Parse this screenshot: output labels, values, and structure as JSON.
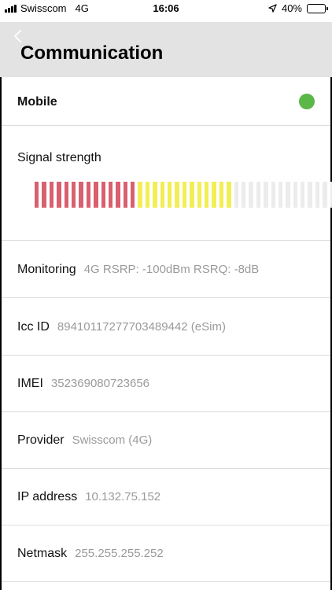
{
  "status_bar": {
    "carrier": "Swisscom",
    "network": "4G",
    "time": "16:06",
    "battery": "40%",
    "battery_level": 0.4,
    "icons": [
      "cell-signal-icon",
      "location-arrow-icon",
      "battery-icon"
    ]
  },
  "nav": {
    "title": "Communication",
    "back_icon": "chevron-left-icon"
  },
  "mobile": {
    "label": "Mobile",
    "status_color": "#5bb748"
  },
  "signal": {
    "label": "Signal strength",
    "segments_total": 42,
    "segments_red": 14,
    "segments_yellow": 13,
    "colors": {
      "red": "#d9606f",
      "yellow": "#f2ee55",
      "empty": "#ececec"
    }
  },
  "info": [
    {
      "label": "Monitoring",
      "value": "4G RSRP: -100dBm RSRQ: -8dB"
    },
    {
      "label": "Icc ID",
      "value": "89410117277703489442 (eSim)"
    },
    {
      "label": "IMEI",
      "value": "352369080723656"
    },
    {
      "label": "Provider",
      "value": "Swisscom (4G)"
    },
    {
      "label": "IP address",
      "value": "10.132.75.152"
    },
    {
      "label": "Netmask",
      "value": "255.255.255.252"
    }
  ]
}
